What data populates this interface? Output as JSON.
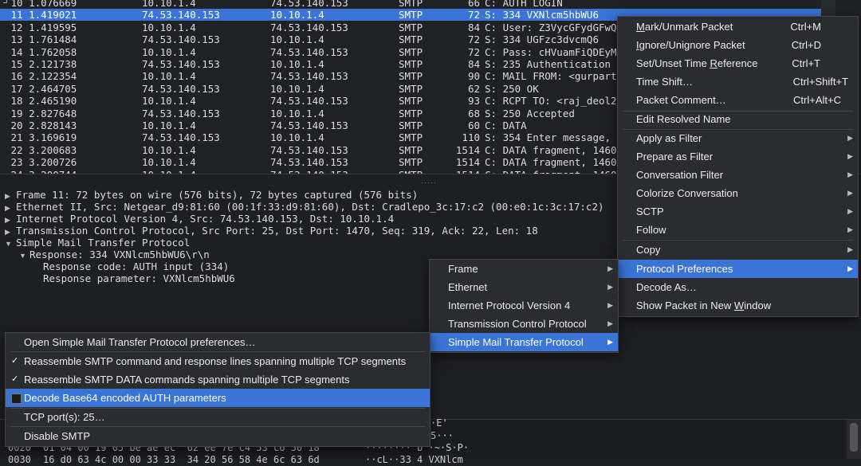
{
  "packet_list": {
    "rows": [
      {
        "no": "10",
        "time": "1.076669",
        "src": "10.10.1.4",
        "dst": "74.53.140.153",
        "proto": "SMTP",
        "len": "66",
        "info": "C: AUTH LOGIN"
      },
      {
        "no": "11",
        "time": "1.419021",
        "src": "74.53.140.153",
        "dst": "10.10.1.4",
        "proto": "SMTP",
        "len": "72",
        "info": "S: 334 VXNlcm5hbWU6",
        "selected": true
      },
      {
        "no": "12",
        "time": "1.419595",
        "src": "10.10.1.4",
        "dst": "74.53.140.153",
        "proto": "SMTP",
        "len": "84",
        "info": "C: User: Z3VycGFydGFwQ"
      },
      {
        "no": "13",
        "time": "1.761484",
        "src": "74.53.140.153",
        "dst": "10.10.1.4",
        "proto": "SMTP",
        "len": "72",
        "info": "S: 334 UGFzc3dvcmQ6"
      },
      {
        "no": "14",
        "time": "1.762058",
        "src": "10.10.1.4",
        "dst": "74.53.140.153",
        "proto": "SMTP",
        "len": "72",
        "info": "C: Pass: cHVuamFiQDEyM"
      },
      {
        "no": "15",
        "time": "2.121738",
        "src": "74.53.140.153",
        "dst": "10.10.1.4",
        "proto": "SMTP",
        "len": "84",
        "info": "S: 235 Authentication"
      },
      {
        "no": "16",
        "time": "2.122354",
        "src": "10.10.1.4",
        "dst": "74.53.140.153",
        "proto": "SMTP",
        "len": "90",
        "info": "C: MAIL FROM: <gurpart"
      },
      {
        "no": "17",
        "time": "2.464705",
        "src": "74.53.140.153",
        "dst": "10.10.1.4",
        "proto": "SMTP",
        "len": "62",
        "info": "S: 250 OK"
      },
      {
        "no": "18",
        "time": "2.465190",
        "src": "10.10.1.4",
        "dst": "74.53.140.153",
        "proto": "SMTP",
        "len": "93",
        "info": "C: RCPT TO: <raj_deol2"
      },
      {
        "no": "19",
        "time": "2.827648",
        "src": "74.53.140.153",
        "dst": "10.10.1.4",
        "proto": "SMTP",
        "len": "68",
        "info": "S: 250 Accepted"
      },
      {
        "no": "20",
        "time": "2.828143",
        "src": "10.10.1.4",
        "dst": "74.53.140.153",
        "proto": "SMTP",
        "len": "60",
        "info": "C: DATA"
      },
      {
        "no": "21",
        "time": "3.169619",
        "src": "74.53.140.153",
        "dst": "10.10.1.4",
        "proto": "SMTP",
        "len": "110",
        "info": "S: 354 Enter message,"
      },
      {
        "no": "22",
        "time": "3.200683",
        "src": "10.10.1.4",
        "dst": "74.53.140.153",
        "proto": "SMTP",
        "len": "1514",
        "info": "C: DATA fragment, 1460"
      },
      {
        "no": "23",
        "time": "3.200726",
        "src": "10.10.1.4",
        "dst": "74.53.140.153",
        "proto": "SMTP",
        "len": "1514",
        "info": "C: DATA fragment, 1460"
      },
      {
        "no": "24",
        "time": "3.200744",
        "src": "10.10.1.4",
        "dst": "74.53.140.153",
        "proto": "SMTP",
        "len": "1514",
        "info": "C: DATA fragment, 1460"
      }
    ]
  },
  "details": {
    "frame": "Frame 11: 72 bytes on wire (576 bits), 72 bytes captured (576 bits)",
    "ethernet": "Ethernet II, Src: Netgear_d9:81:60 (00:1f:33:d9:81:60), Dst: Cradlepo_3c:17:c2 (00:e0:1c:3c:17:c2)",
    "ip": "Internet Protocol Version 4, Src: 74.53.140.153, Dst: 10.10.1.4",
    "tcp": "Transmission Control Protocol, Src Port: 25, Dst Port: 1470, Seq: 319, Ack: 22, Len: 18",
    "smtp": "Simple Mail Transfer Protocol",
    "response": "Response: 334 VXNlcm5hbWU6\\r\\n",
    "response_code": "Response code: AUTH input (334)",
    "response_param": "Response parameter: VXNlcm5hbWU6"
  },
  "hex": {
    "row0_ascii": "·E'",
    "row1_ascii": "5···",
    "row2_offset": "0020",
    "row2_hex": "01 04 00 19 05 be ae ec  62 ee 7e c4 53 c6 50 18",
    "row2_ascii": "········ b ·~·S·P·",
    "row3_offset": "0030",
    "row3_hex": "16 d0 63 4c 00 00 33 33  34 20 56 58 4e 6c 63 6d",
    "row3_ascii": "··cL··33 4 VXNlcm"
  },
  "context_menu": {
    "mark_prefix": "",
    "mark_u": "M",
    "mark_rest": "ark/Unmark Packet",
    "mark_sc": "Ctrl+M",
    "ignore_prefix": "",
    "ignore_u": "I",
    "ignore_rest": "gnore/Unignore Packet",
    "ignore_sc": "Ctrl+D",
    "time_ref_prefix": "Set/Unset Time ",
    "time_ref_u": "R",
    "time_ref_rest": "eference",
    "time_ref_sc": "Ctrl+T",
    "time_shift": "Time Shift…",
    "time_shift_sc": "Ctrl+Shift+T",
    "comment": "Packet Comment…",
    "comment_sc": "Ctrl+Alt+C",
    "edit_name": "Edit Resolved Name",
    "apply_filter": "Apply as Filter",
    "prepare_filter": "Prepare as Filter",
    "conv_filter": "Conversation Filter",
    "colorize": "Colorize Conversation",
    "sctp": "SCTP",
    "follow": "Follow",
    "copy": "Copy",
    "proto_prefs": "Protocol Preferences",
    "decode_as": "Decode As…",
    "show_new_prefix": "Show Packet in New ",
    "show_new_u": "W",
    "show_new_rest": "indow"
  },
  "protocol_menu": {
    "frame": "Frame",
    "ethernet": "Ethernet",
    "ipv4": "Internet Protocol Version 4",
    "tcp": "Transmission Control Protocol",
    "smtp": "Simple Mail Transfer Protocol"
  },
  "smtp_menu": {
    "open_prefs": "Open Simple Mail Transfer Protocol preferences…",
    "reassemble_cmd": "Reassemble SMTP command and response lines spanning multiple TCP segments",
    "reassemble_data": "Reassemble SMTP DATA commands spanning multiple TCP segments",
    "decode_b64": "Decode Base64 encoded AUTH parameters",
    "tcp_ports": "TCP port(s): 25…",
    "disable": "Disable SMTP"
  }
}
